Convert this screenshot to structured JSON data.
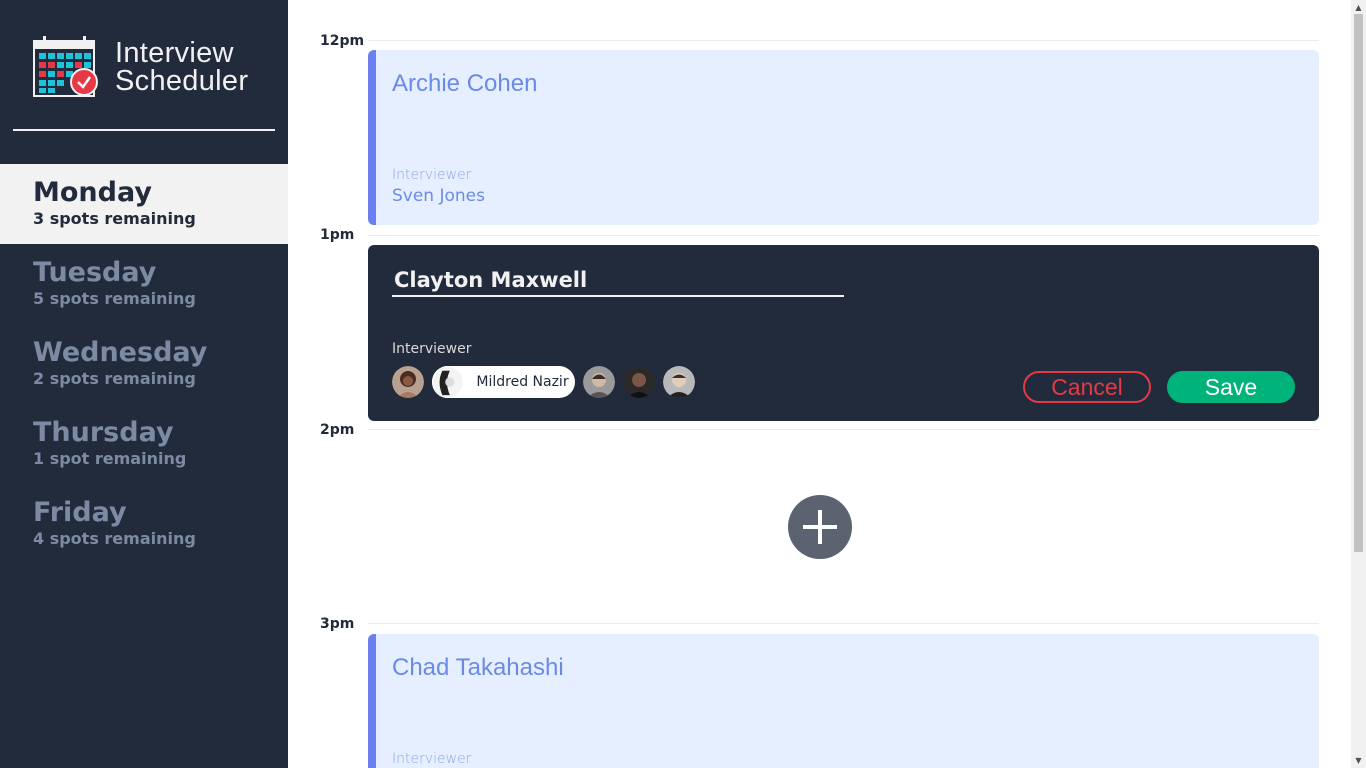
{
  "brand": {
    "title_line1": "Interview",
    "title_line2": "Scheduler"
  },
  "days": [
    {
      "name": "Monday",
      "spots": "3 spots remaining",
      "selected": true
    },
    {
      "name": "Tuesday",
      "spots": "5 spots remaining",
      "selected": false
    },
    {
      "name": "Wednesday",
      "spots": "2 spots remaining",
      "selected": false
    },
    {
      "name": "Thursday",
      "spots": "1 spot remaining",
      "selected": false
    },
    {
      "name": "Friday",
      "spots": "4 spots remaining",
      "selected": false
    }
  ],
  "times": [
    "12pm",
    "1pm",
    "2pm",
    "3pm"
  ],
  "appointments": [
    {
      "student": "Archie Cohen",
      "interviewer_label": "Interviewer",
      "interviewer": "Sven Jones"
    },
    {
      "student": "Chad Takahashi",
      "interviewer_label": "Interviewer"
    }
  ],
  "form": {
    "student_value": "Clayton Maxwell",
    "interviewer_label": "Interviewer",
    "selected_interviewer": "Mildred Nazir",
    "cancel_label": "Cancel",
    "save_label": "Save"
  },
  "colors": {
    "sidebar_bg": "#222b3c",
    "appointment_bg": "#e6efff",
    "accent_blue": "#6b7ff0",
    "cancel_red": "#e63946",
    "save_green": "#00b37a"
  }
}
